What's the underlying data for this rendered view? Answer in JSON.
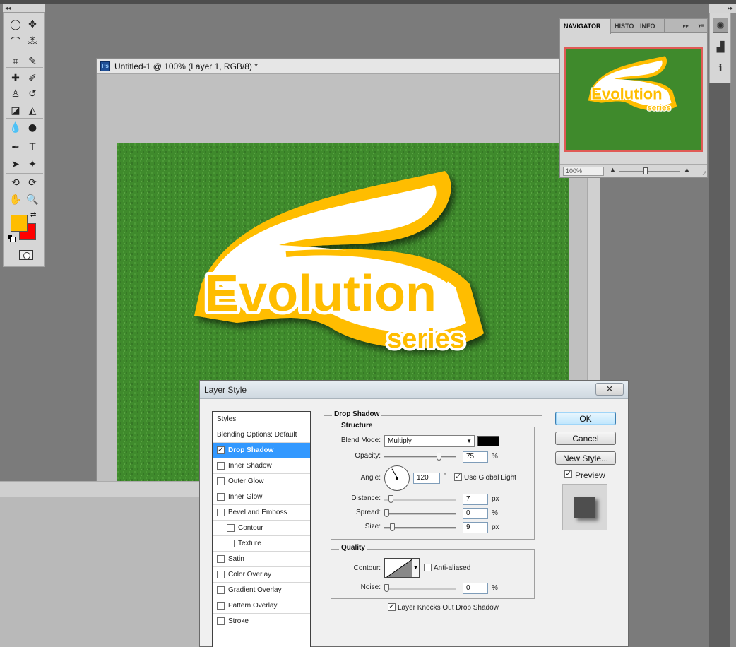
{
  "tools_panel": {
    "collapse_glyph": "◂◂",
    "tools": [
      {
        "name": "marquee-tool",
        "glyph": "◯"
      },
      {
        "name": "move-tool",
        "glyph": "✥"
      },
      {
        "name": "lasso-tool",
        "glyph": "⌒"
      },
      {
        "name": "magic-wand-tool",
        "glyph": "⁂"
      },
      {
        "name": "crop-tool",
        "glyph": "⌗"
      },
      {
        "name": "eyedropper-tool",
        "glyph": "✎"
      },
      {
        "name": "healing-brush-tool",
        "glyph": "✚"
      },
      {
        "name": "brush-tool",
        "glyph": "✐"
      },
      {
        "name": "clone-stamp-tool",
        "glyph": "♙"
      },
      {
        "name": "history-brush-tool",
        "glyph": "↺"
      },
      {
        "name": "eraser-tool",
        "glyph": "◪"
      },
      {
        "name": "paint-bucket-tool",
        "glyph": "◭"
      },
      {
        "name": "blur-tool",
        "glyph": "💧"
      },
      {
        "name": "dodge-tool",
        "glyph": "●"
      },
      {
        "name": "pen-tool",
        "glyph": "✒"
      },
      {
        "name": "type-tool",
        "glyph": "T"
      },
      {
        "name": "path-selection-tool",
        "glyph": "➤"
      },
      {
        "name": "shape-tool",
        "glyph": "✦"
      },
      {
        "name": "3d-rotate-tool",
        "glyph": "⟲"
      },
      {
        "name": "3d-orbit-tool",
        "glyph": "⟳"
      },
      {
        "name": "hand-tool",
        "glyph": "✋"
      },
      {
        "name": "zoom-tool",
        "glyph": "🔍"
      }
    ],
    "foreground_color": "#ffbd00",
    "background_color": "#ff0000",
    "swap_glyph": "⇄"
  },
  "document": {
    "title": "Untitled-1 @ 100% (Layer 1, RGB/8) *",
    "app_icon_text": "Ps",
    "logo_word": "Evolution",
    "logo_sub": "series",
    "logo_fill": "#ffbd00",
    "grass_color": "#3f8a2c"
  },
  "right_dock": {
    "collapse_glyph": "▸▸",
    "buttons": [
      {
        "name": "navigator-panel-icon",
        "glyph": "✺",
        "active": true
      },
      {
        "name": "histogram-panel-icon",
        "glyph": "▟",
        "active": false
      },
      {
        "name": "info-panel-icon",
        "glyph": "ℹ",
        "active": false
      }
    ]
  },
  "navigator": {
    "tabs": [
      "NAVIGATOR",
      "HISTO",
      "INFO"
    ],
    "more_glyph": "▸▸",
    "menu_glyph": "▾≡",
    "zoom_value": "100%",
    "zoom_out_glyph": "▲",
    "zoom_in_glyph": "▲",
    "slider_level": 0.43
  },
  "layer_style": {
    "title": "Layer Style",
    "close_glyph": "✕",
    "styles": [
      {
        "label": "Styles",
        "type": "head"
      },
      {
        "label": "Blending Options: Default",
        "type": "head"
      },
      {
        "label": "Drop Shadow",
        "checked": true,
        "selected": true
      },
      {
        "label": "Inner Shadow",
        "checked": false
      },
      {
        "label": "Outer Glow",
        "checked": false
      },
      {
        "label": "Inner Glow",
        "checked": false
      },
      {
        "label": "Bevel and Emboss",
        "checked": false
      },
      {
        "label": "Contour",
        "checked": false,
        "indent": true
      },
      {
        "label": "Texture",
        "checked": false,
        "indent": true
      },
      {
        "label": "Satin",
        "checked": false
      },
      {
        "label": "Color Overlay",
        "checked": false
      },
      {
        "label": "Gradient Overlay",
        "checked": false
      },
      {
        "label": "Pattern Overlay",
        "checked": false
      },
      {
        "label": "Stroke",
        "checked": false
      }
    ],
    "drop_shadow": {
      "section_title": "Drop Shadow",
      "structure_title": "Structure",
      "blend_mode_label": "Blend Mode:",
      "blend_mode_value": "Multiply",
      "shadow_color": "#000000",
      "opacity_label": "Opacity:",
      "opacity_value": "75",
      "opacity_unit": "%",
      "angle_label": "Angle:",
      "angle_value": "120",
      "angle_unit": "°",
      "use_global_light_label": "Use Global Light",
      "use_global_light": true,
      "distance_label": "Distance:",
      "distance_value": "7",
      "distance_unit": "px",
      "spread_label": "Spread:",
      "spread_value": "0",
      "spread_unit": "%",
      "size_label": "Size:",
      "size_value": "9",
      "size_unit": "px",
      "quality_title": "Quality",
      "contour_label": "Contour:",
      "anti_aliased_label": "Anti-aliased",
      "anti_aliased": false,
      "noise_label": "Noise:",
      "noise_value": "0",
      "noise_unit": "%",
      "knockout_label": "Layer Knocks Out Drop Shadow",
      "knockout": true
    },
    "buttons": {
      "ok": "OK",
      "cancel": "Cancel",
      "new_style": "New Style...",
      "preview_label": "Preview",
      "preview_checked": true
    }
  }
}
